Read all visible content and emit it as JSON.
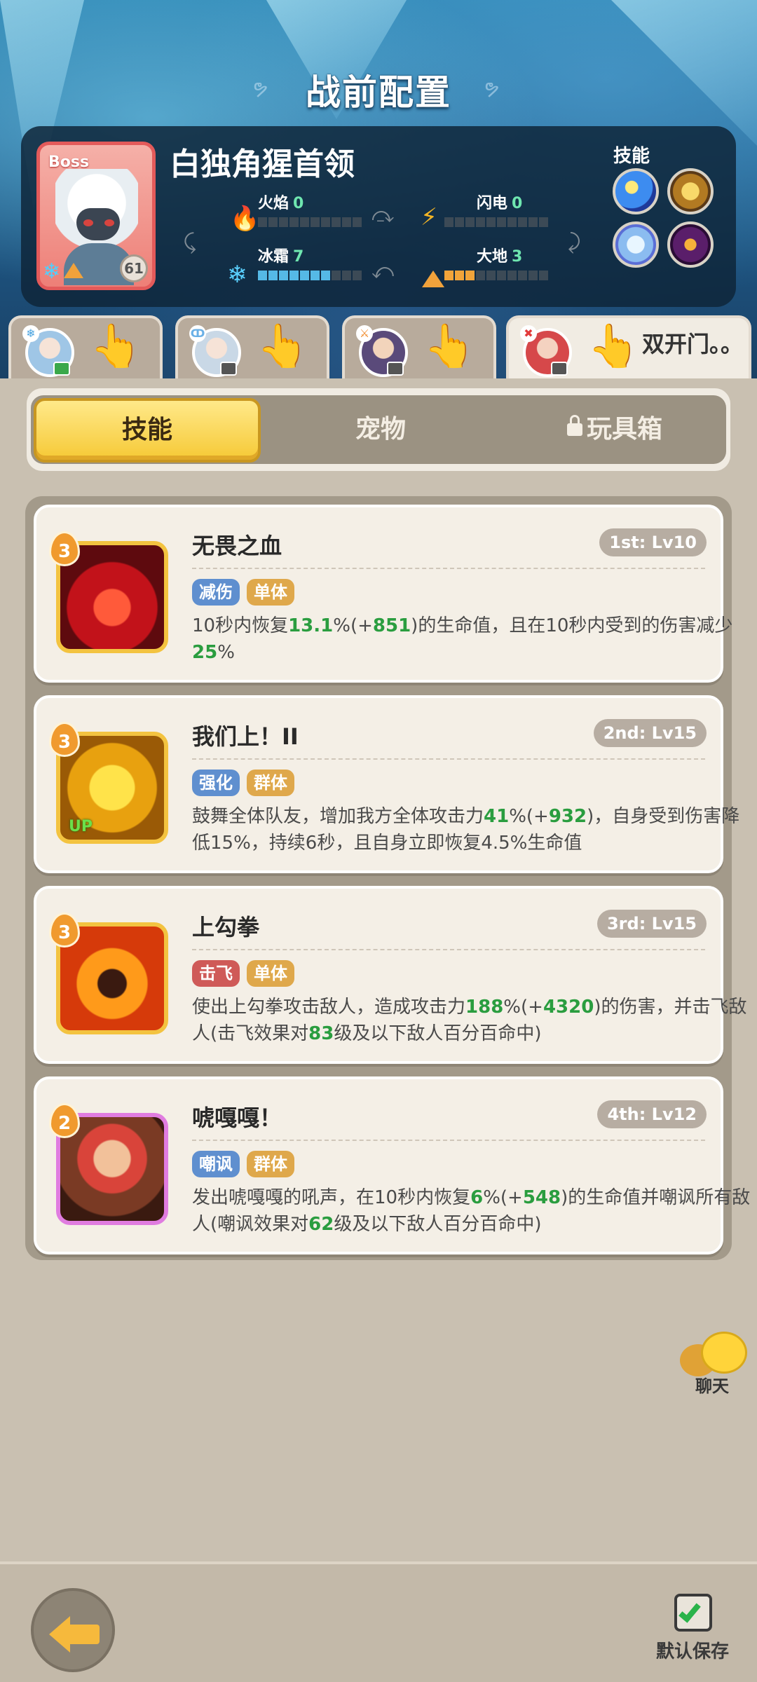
{
  "page": {
    "title": "战前配置"
  },
  "boss": {
    "tag": "Boss",
    "name": "白独角猩首领",
    "level": "61",
    "stats": {
      "fire": {
        "label": "火焰",
        "value": "0",
        "filled": 0
      },
      "lightning": {
        "label": "闪电",
        "value": "0",
        "filled": 0
      },
      "frost": {
        "label": "冰霜",
        "value": "7",
        "filled": 7
      },
      "earth": {
        "label": "大地",
        "value": "3",
        "filled": 3
      }
    },
    "skills_label": "技能",
    "skill_icons": [
      "star-burst-icon",
      "golden-beast-icon",
      "ice-crystal-icon",
      "dark-flame-icon"
    ]
  },
  "heroes": [
    {
      "name": "",
      "avatar": "blue-hair-girl-avatar",
      "active": false
    },
    {
      "name": "",
      "avatar": "silver-hair-girl-avatar",
      "active": false
    },
    {
      "name": "",
      "avatar": "purple-hair-boy-avatar",
      "active": false
    },
    {
      "name": "双开门。。",
      "avatar": "red-hair-girl-avatar",
      "active": true
    }
  ],
  "tabs": [
    {
      "label": "技能",
      "active": true,
      "locked": false
    },
    {
      "label": "宠物",
      "active": false,
      "locked": false
    },
    {
      "label": "玩具箱",
      "active": false,
      "locked": true
    }
  ],
  "skills": [
    {
      "rank": "3",
      "name": "无畏之血",
      "slot": "1st: Lv10",
      "tags": [
        "减伤",
        "单体"
      ],
      "desc_parts": [
        "10秒内恢复",
        "13.1",
        "%(+",
        "851",
        ")的生命值，且在10秒内受到的伤害减少",
        "25",
        "%"
      ]
    },
    {
      "rank": "3",
      "name": "我们上！II",
      "slot": "2nd: Lv15",
      "tags": [
        "强化",
        "群体"
      ],
      "desc_parts": [
        "鼓舞全体队友，增加我方全体攻击力",
        "41",
        "%(+",
        "932",
        ")，自身受到伤害降低15%，持续6秒，且自身立即恢复4.5%生命值"
      ]
    },
    {
      "rank": "3",
      "name": "上勾拳",
      "slot": "3rd: Lv15",
      "tags": [
        "击飞",
        "单体"
      ],
      "desc_parts": [
        "使出上勾拳攻击敌人，造成攻击力",
        "188",
        "%(+",
        "4320",
        ")的伤害，并击飞敌人(击飞效果对",
        "83",
        "级及以下敌人百分百命中)"
      ]
    },
    {
      "rank": "2",
      "name": "唬嘎嘎！",
      "slot": "4th: Lv12",
      "tags": [
        "嘲讽",
        "群体"
      ],
      "desc_parts": [
        "发出唬嘎嘎的吼声，在10秒内恢复",
        "6",
        "%(+",
        "548",
        ")的生命值并嘲讽所有敌人(嘲讽效果对",
        "62",
        "级及以下敌人百分百命中)"
      ]
    }
  ],
  "chat": {
    "label": "聊天"
  },
  "footer": {
    "save_label": "默认保存"
  }
}
